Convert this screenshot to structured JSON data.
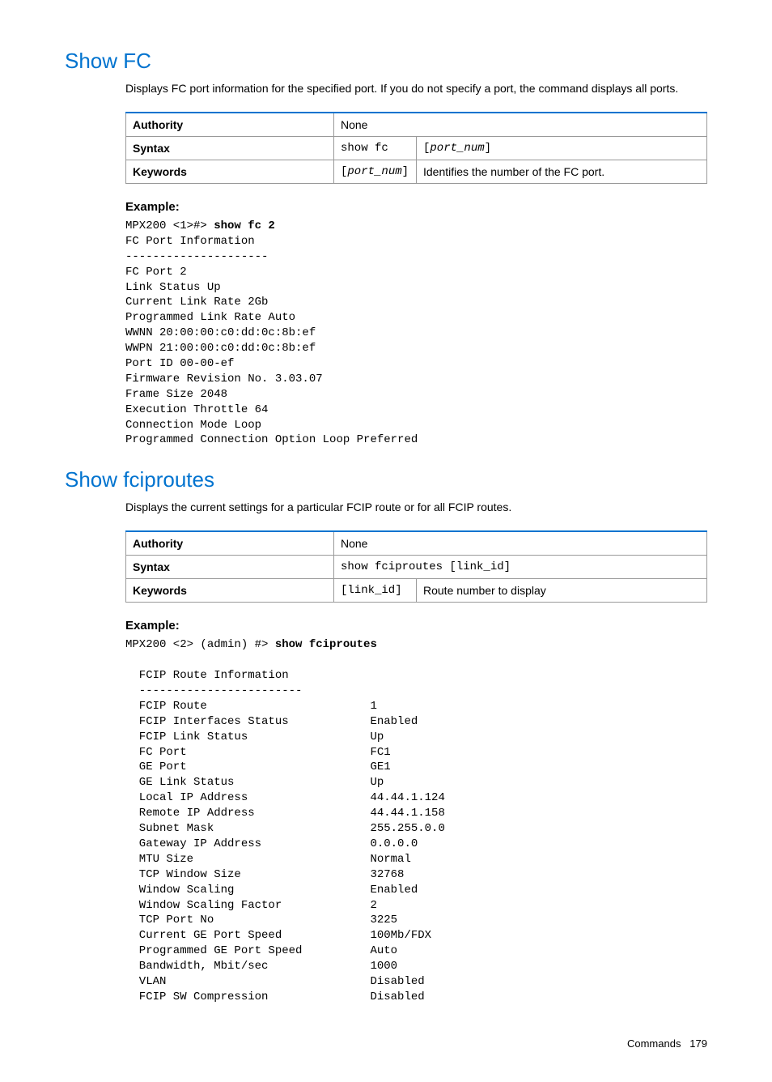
{
  "section1": {
    "title": "Show FC",
    "desc": "Displays FC port information for the specified port. If you do not specify a port, the command displays all ports.",
    "table": {
      "authority_label": "Authority",
      "authority_value": "None",
      "syntax_label": "Syntax",
      "syntax_cmd": "show fc",
      "syntax_arg": "[port_num]",
      "keywords_label": "Keywords",
      "keywords_arg": "[port_num]",
      "keywords_desc": "Identifies the number of the FC port."
    },
    "example_label": "Example:",
    "example_prompt": "MPX200 <1>#> ",
    "example_cmd": "show fc 2",
    "example_output": "FC Port Information\n---------------------\nFC Port 2\nLink Status Up\nCurrent Link Rate 2Gb\nProgrammed Link Rate Auto\nWWNN 20:00:00:c0:dd:0c:8b:ef\nWWPN 21:00:00:c0:dd:0c:8b:ef\nPort ID 00-00-ef\nFirmware Revision No. 3.03.07\nFrame Size 2048\nExecution Throttle 64\nConnection Mode Loop\nProgrammed Connection Option Loop Preferred"
  },
  "section2": {
    "title": "Show fciproutes",
    "desc": "Displays the current settings for a particular FCIP route or for all FCIP routes.",
    "table": {
      "authority_label": "Authority",
      "authority_value": "None",
      "syntax_label": "Syntax",
      "syntax_full": "show fciproutes [link_id]",
      "keywords_label": "Keywords",
      "keywords_arg": "[link_id]",
      "keywords_desc": "Route number to display"
    },
    "example_label": "Example:",
    "example_prompt": "MPX200 <2> (admin) #> ",
    "example_cmd": "show fciproutes",
    "example_output": "\n  FCIP Route Information\n  ------------------------\n  FCIP Route                        1\n  FCIP Interfaces Status            Enabled\n  FCIP Link Status                  Up\n  FC Port                           FC1\n  GE Port                           GE1\n  GE Link Status                    Up\n  Local IP Address                  44.44.1.124\n  Remote IP Address                 44.44.1.158\n  Subnet Mask                       255.255.0.0\n  Gateway IP Address                0.0.0.0\n  MTU Size                          Normal\n  TCP Window Size                   32768\n  Window Scaling                    Enabled\n  Window Scaling Factor             2\n  TCP Port No                       3225\n  Current GE Port Speed             100Mb/FDX\n  Programmed GE Port Speed          Auto\n  Bandwidth, Mbit/sec               1000\n  VLAN                              Disabled\n  FCIP SW Compression               Disabled"
  },
  "footer": {
    "section": "Commands",
    "page": "179"
  }
}
